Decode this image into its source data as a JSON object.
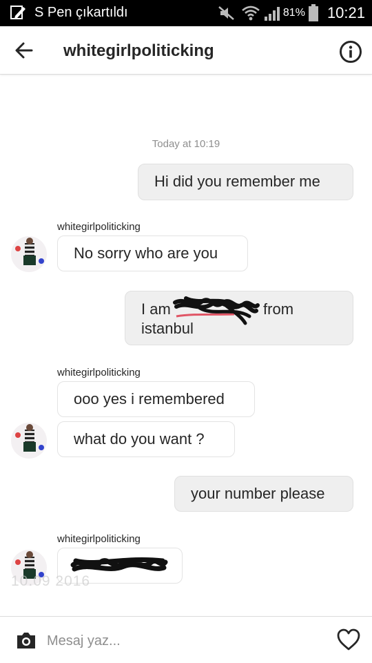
{
  "status_bar": {
    "notification_text": "S Pen çıkartıldı",
    "battery_percent": "81%",
    "time": "10:21"
  },
  "header": {
    "title": "whitegirlpoliticking"
  },
  "chat": {
    "timestamp": "Today at 10:19",
    "messages": [
      {
        "text": "Hi did you remember me"
      },
      {
        "sender": "whitegirlpoliticking",
        "text": "No sorry who are you"
      },
      {
        "text_before": "I am ",
        "text_after": " from",
        "text_line2": "istanbul"
      },
      {
        "sender": "whitegirlpoliticking",
        "text": "ooo yes i remembered"
      },
      {
        "text": "what do you want ?"
      },
      {
        "text": "your number please"
      },
      {
        "sender": "whitegirlpoliticking",
        "text": ""
      }
    ],
    "watermark": "10.09 2016"
  },
  "composer": {
    "placeholder": "Mesaj yaz..."
  },
  "icons": {
    "back": "arrow-left-icon",
    "info": "info-icon",
    "camera": "camera-icon",
    "heart": "heart-icon"
  }
}
